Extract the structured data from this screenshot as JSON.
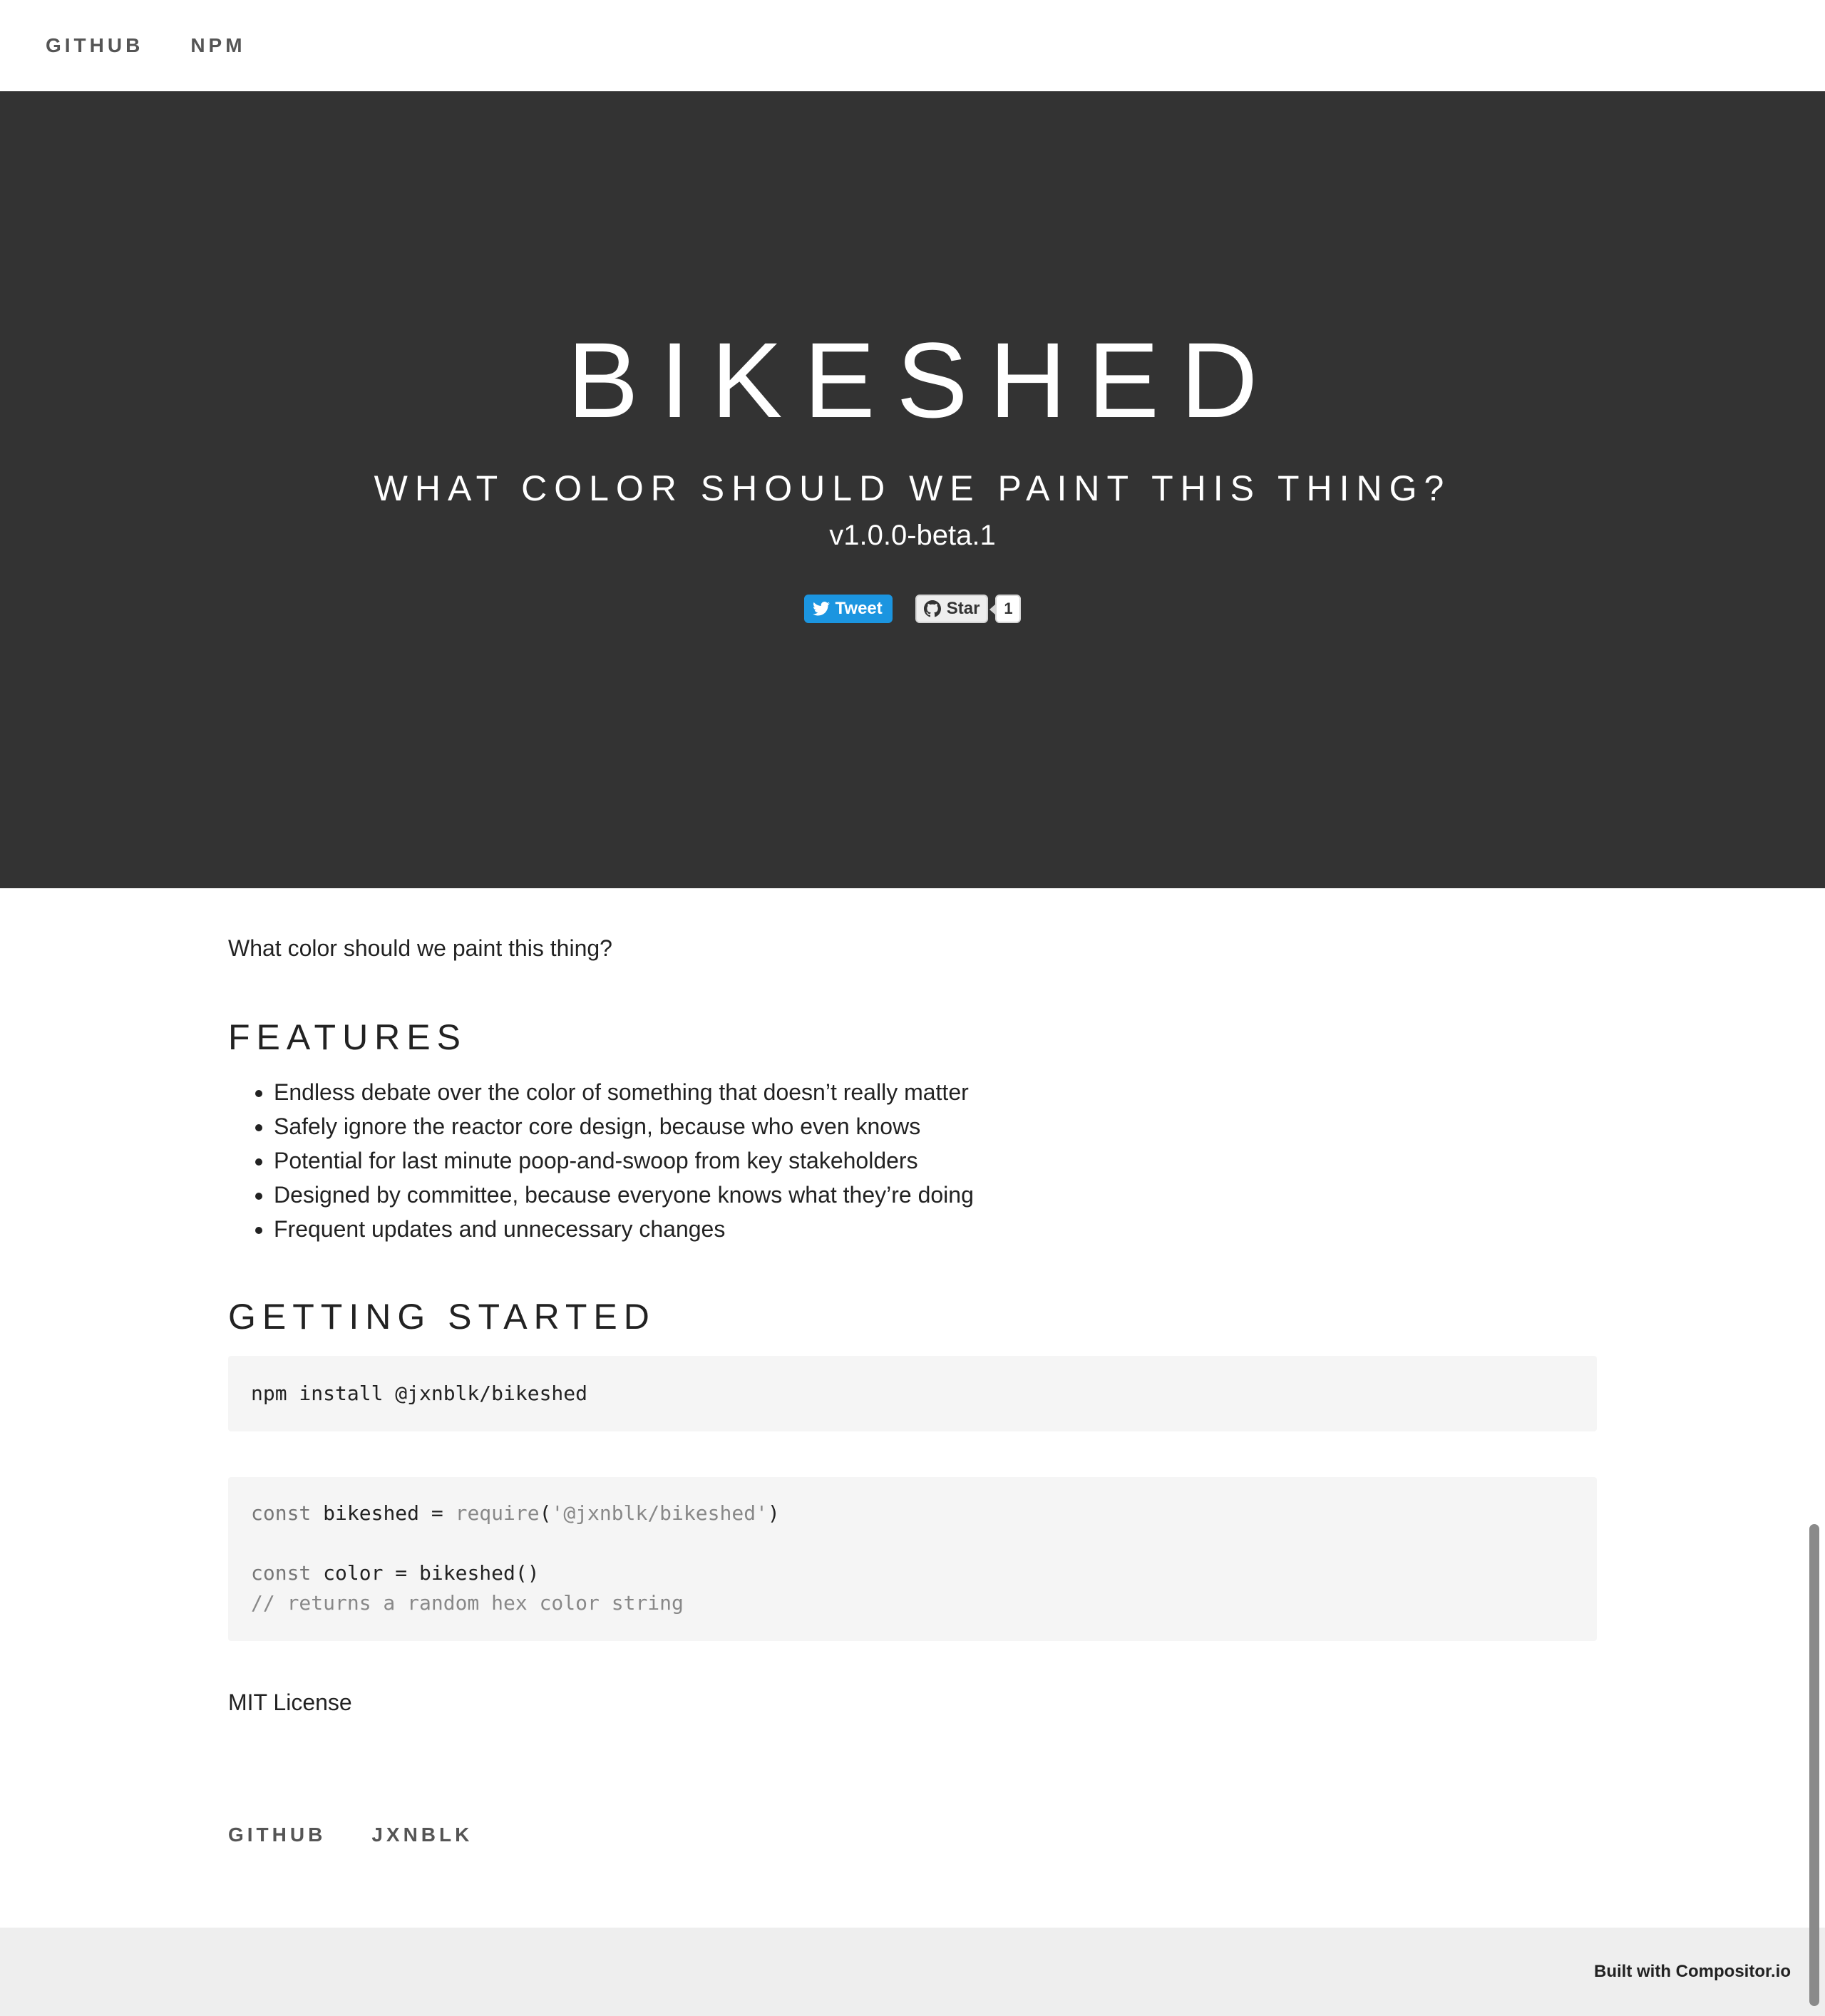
{
  "nav": {
    "links": [
      "GITHUB",
      "NPM"
    ]
  },
  "hero": {
    "title": "BIKESHED",
    "subtitle": "WHAT COLOR SHOULD WE PAINT THIS THING?",
    "version": "v1.0.0-beta.1",
    "tweet_label": "Tweet",
    "star_label": "Star",
    "star_count": "1"
  },
  "main": {
    "intro": "What color should we paint this thing?",
    "features_heading": "FEATURES",
    "features": [
      "Endless debate over the color of something that doesn’t really matter",
      "Safely ignore the reactor core design, because who even knows",
      "Potential for last minute poop-and-swoop from key stakeholders",
      "Designed by committee, because everyone knows what they’re doing",
      "Frequent updates and unnecessary changes"
    ],
    "getting_started_heading": "GETTING STARTED",
    "install_command": "npm install @jxnblk/bikeshed",
    "usage": {
      "line1_kw": "const",
      "line1_var": " bikeshed = ",
      "line1_fn": "require",
      "line1_open": "(",
      "line1_str": "'@jxnblk/bikeshed'",
      "line1_close": ")",
      "line2_kw": "const",
      "line2_rest": " color = bikeshed()",
      "line3_comment": "// returns a random hex color string"
    },
    "license": "MIT License"
  },
  "footer": {
    "links": [
      "GITHUB",
      "JXNBLK"
    ],
    "built_with": "Built with Compositor.io"
  },
  "colors": {
    "hero_bg": "#333333",
    "tweet_bg": "#1b95e0",
    "code_bg": "#f5f5f5",
    "bottom_bar_bg": "#eeeeee"
  },
  "icons": {
    "tweet": "twitter-bird-icon",
    "star": "github-octocat-icon"
  }
}
